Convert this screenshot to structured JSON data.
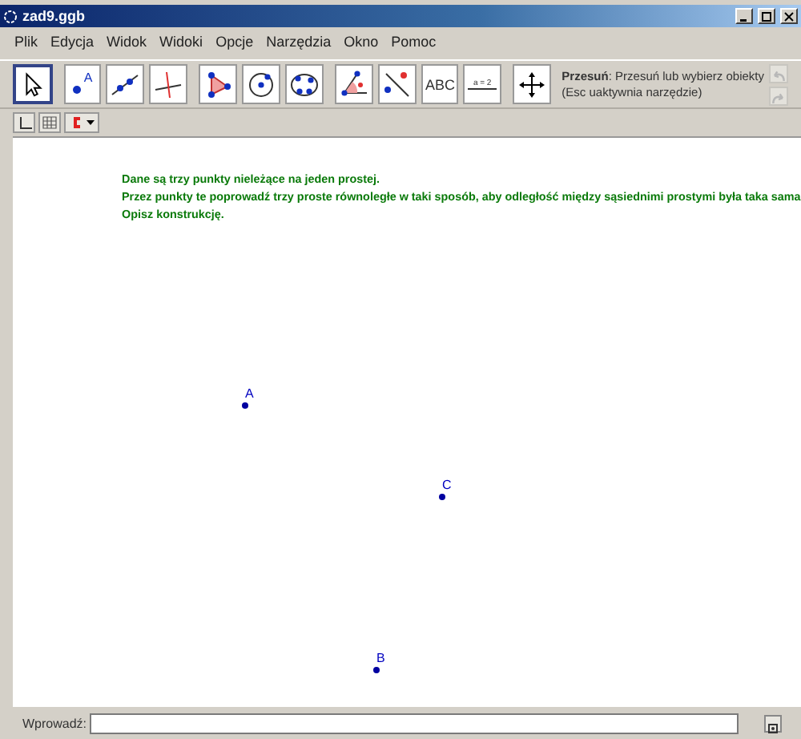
{
  "window": {
    "title": "zad9.ggb"
  },
  "menu": [
    "Plik",
    "Edycja",
    "Widok",
    "Widoki",
    "Opcje",
    "Narzędzia",
    "Okno",
    "Pomoc"
  ],
  "tools": [
    {
      "kind": "move",
      "selected": true
    },
    {
      "kind": "point",
      "label": "A",
      "selected": false
    },
    {
      "kind": "line",
      "selected": false
    },
    {
      "kind": "perpendicular",
      "selected": false
    },
    {
      "kind": "polygon",
      "selected": false
    },
    {
      "kind": "circle",
      "selected": false
    },
    {
      "kind": "conic",
      "selected": false
    },
    {
      "kind": "angle",
      "selected": false
    },
    {
      "kind": "reflect",
      "selected": false
    },
    {
      "kind": "text",
      "label": "ABC",
      "selected": false
    },
    {
      "kind": "slider",
      "label": "a = 2",
      "selected": false
    },
    {
      "kind": "pan",
      "selected": false
    }
  ],
  "tool_help": {
    "name": "Przesuń",
    "text": ": Przesuń lub wybierz obiekty",
    "hint": "(Esc uaktywnia narzędzie)"
  },
  "style_bar": [
    {
      "kind": "axes"
    },
    {
      "kind": "grid"
    },
    {
      "kind": "capture"
    }
  ],
  "canvas": {
    "text": [
      "Dane są trzy punkty nieleżące na jeden prostej.",
      "Przez punkty te poprowadź trzy proste równoległe w taki sposób, aby odległość między sąsiednimi prostymi była taka sama",
      "Opisz konstrukcję."
    ],
    "points": [
      {
        "label": "A"
      },
      {
        "label": "C"
      },
      {
        "label": "B"
      }
    ]
  },
  "input_bar": {
    "label": "Wprowadź:"
  }
}
